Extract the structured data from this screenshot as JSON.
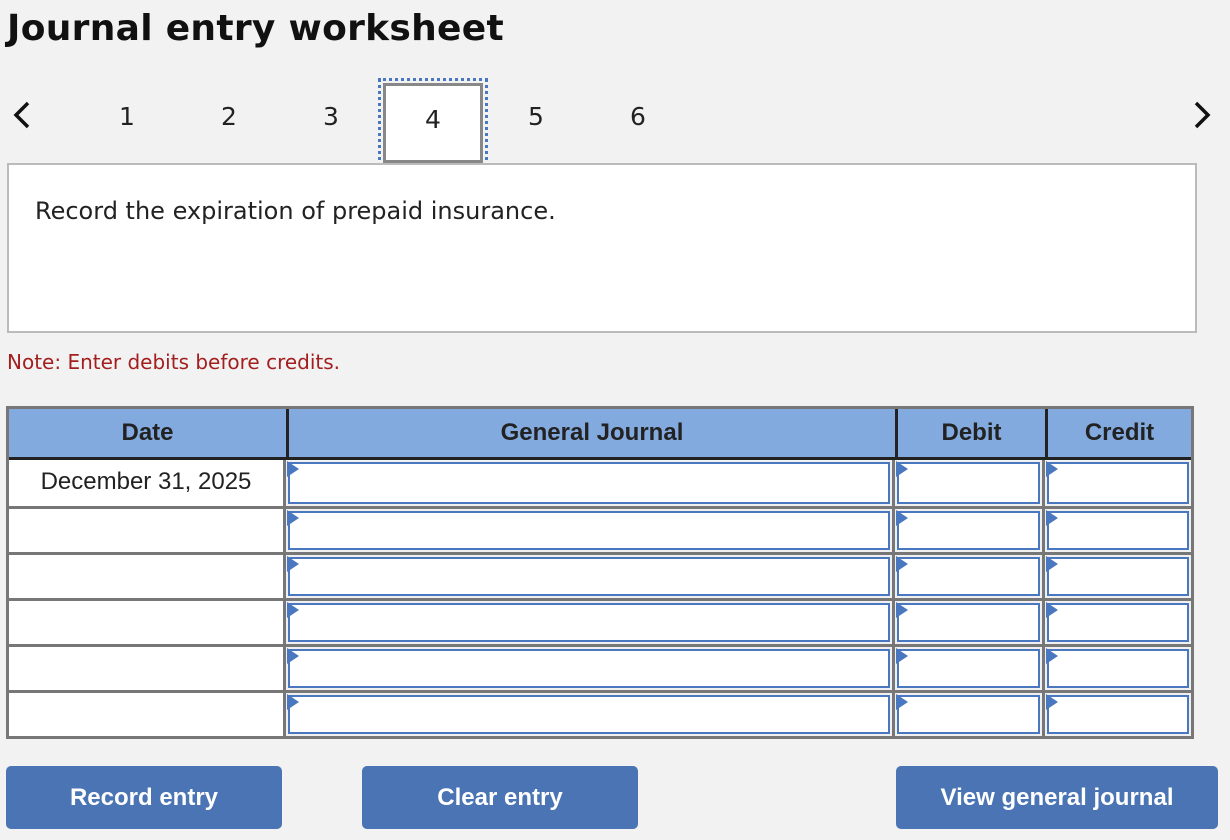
{
  "title": "Journal entry worksheet",
  "nav": {
    "prev_icon": "chevron-left-icon",
    "next_icon": "chevron-right-icon",
    "tabs": [
      "1",
      "2",
      "3",
      "4",
      "5",
      "6"
    ],
    "active_tab": "4"
  },
  "prompt": "Record the expiration of prepaid insurance.",
  "note": "Note: Enter debits before credits.",
  "table": {
    "headers": {
      "date": "Date",
      "general_journal": "General Journal",
      "debit": "Debit",
      "credit": "Credit"
    },
    "rows": [
      {
        "date": "December 31, 2025",
        "account": "",
        "debit": "",
        "credit": ""
      },
      {
        "date": "",
        "account": "",
        "debit": "",
        "credit": ""
      },
      {
        "date": "",
        "account": "",
        "debit": "",
        "credit": ""
      },
      {
        "date": "",
        "account": "",
        "debit": "",
        "credit": ""
      },
      {
        "date": "",
        "account": "",
        "debit": "",
        "credit": ""
      },
      {
        "date": "",
        "account": "",
        "debit": "",
        "credit": ""
      }
    ]
  },
  "buttons": {
    "record": "Record entry",
    "clear": "Clear entry",
    "view": "View general journal"
  },
  "colors": {
    "header_bg": "#82aadf",
    "button_bg": "#4a74b3",
    "note_color": "#a31f1f",
    "input_border": "#4a78c0"
  }
}
